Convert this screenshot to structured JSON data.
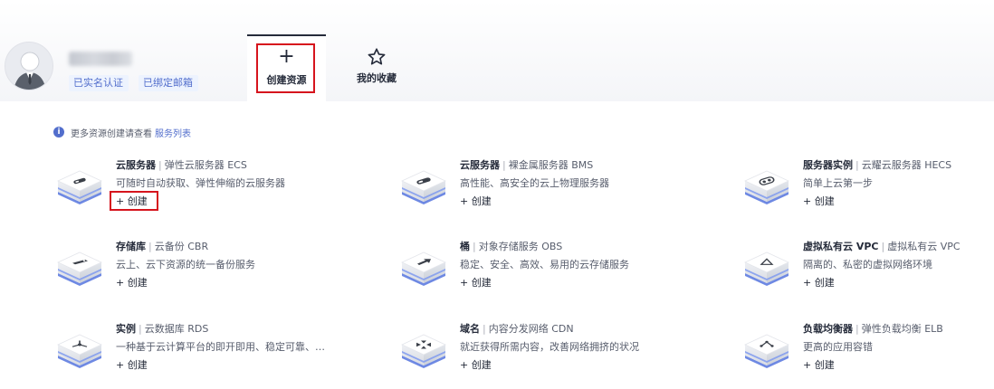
{
  "header": {
    "badges": [
      "已实名认证",
      "已绑定邮箱"
    ],
    "tabs": {
      "create": {
        "icon": "plus-icon",
        "label": "创建资源"
      },
      "favorites": {
        "icon": "star-icon",
        "label": "我的收藏"
      }
    }
  },
  "info": {
    "icon": "info-icon",
    "text": "更多资源创建请查看",
    "link": "服务列表"
  },
  "cards": [
    {
      "name": "云服务器",
      "service": "弹性云服务器 ECS",
      "desc": "可随时自动获取、弹性伸缩的云服务器",
      "create": "+ 创建",
      "icon": "ecs-cube-icon"
    },
    {
      "name": "云服务器",
      "service": "裸金属服务器 BMS",
      "desc": "高性能、高安全的云上物理服务器",
      "create": "+ 创建",
      "icon": "bms-cube-icon"
    },
    {
      "name": "服务器实例",
      "service": "云耀云服务器 HECS",
      "desc": "简单上云第一步",
      "create": "+ 创建",
      "icon": "hecs-cube-icon"
    },
    {
      "name": "存储库",
      "service": "云备份 CBR",
      "desc": "云上、云下资源的统一备份服务",
      "create": "+ 创建",
      "icon": "cbr-cube-icon"
    },
    {
      "name": "桶",
      "service": "对象存储服务 OBS",
      "desc": "稳定、安全、高效、易用的云存储服务",
      "create": "+ 创建",
      "icon": "obs-cube-icon"
    },
    {
      "name": "虚拟私有云 VPC",
      "service": "虚拟私有云 VPC",
      "desc": "隔离的、私密的虚拟网络环境",
      "create": "+ 创建",
      "icon": "vpc-cube-icon"
    },
    {
      "name": "实例",
      "service": "云数据库 RDS",
      "desc": "一种基于云计算平台的即开即用、稳定可靠、弹性伸缩、便捷管理的在线关系型数据库服务",
      "create": "+ 创建",
      "icon": "rds-cube-icon"
    },
    {
      "name": "域名",
      "service": "内容分发网络 CDN",
      "desc": "就近获得所需内容，改善网络拥挤的状况",
      "create": "+ 创建",
      "icon": "cdn-cube-icon"
    },
    {
      "name": "负载均衡器",
      "service": "弹性负载均衡 ELB",
      "desc": "更高的应用容错",
      "create": "+ 创建",
      "icon": "elb-cube-icon"
    }
  ]
}
